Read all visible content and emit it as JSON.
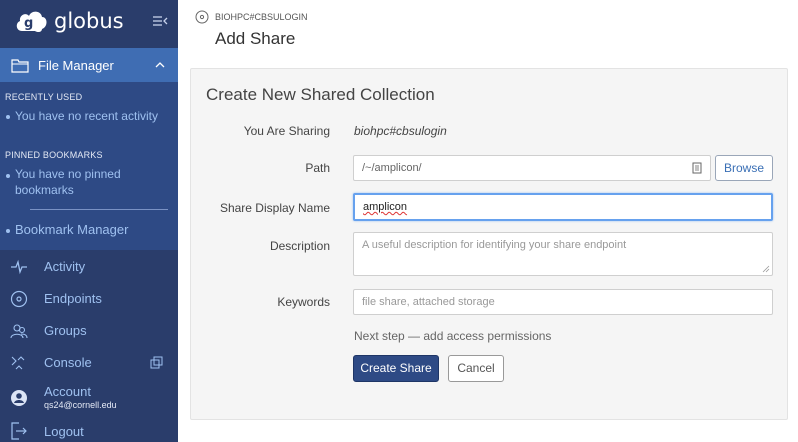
{
  "brand": {
    "name": "globus"
  },
  "sidebar": {
    "file_manager": "File Manager",
    "recently_used_head": "RECENTLY USED",
    "recently_used_item": "You have no recent activity",
    "pinned_head": "PINNED BOOKMARKS",
    "pinned_item": "You have no pinned bookmarks",
    "bookmark_manager": "Bookmark Manager",
    "nav": [
      {
        "label": "Activity",
        "icon": "activity-icon"
      },
      {
        "label": "Endpoints",
        "icon": "endpoint-icon"
      },
      {
        "label": "Groups",
        "icon": "groups-icon"
      },
      {
        "label": "Console",
        "icon": "console-icon"
      },
      {
        "label": "Account",
        "sub": "qs24@cornell.edu",
        "icon": "account-icon"
      },
      {
        "label": "Logout",
        "icon": "logout-icon"
      }
    ]
  },
  "header": {
    "breadcrumb": "BIOHPC#CBSULOGIN",
    "title": "Add Share"
  },
  "form": {
    "title": "Create New Shared Collection",
    "sharing_label": "You Are Sharing",
    "sharing_value": "biohpc#cbsulogin",
    "path_label": "Path",
    "path_value": "/~/amplicon/",
    "browse_label": "Browse",
    "display_name_label": "Share Display Name",
    "display_name_value": "amplicon",
    "description_label": "Description",
    "description_placeholder": "A useful description for identifying your share endpoint",
    "keywords_label": "Keywords",
    "keywords_placeholder": "file share, attached storage",
    "next_step": "Next step — add access permissions",
    "create_label": "Create Share",
    "cancel_label": "Cancel"
  },
  "colors": {
    "sidebar_bg": "#2a3d6b",
    "active_bg": "#3f6db3",
    "primary_button": "#2e4a85",
    "link": "#9fc1f0"
  }
}
